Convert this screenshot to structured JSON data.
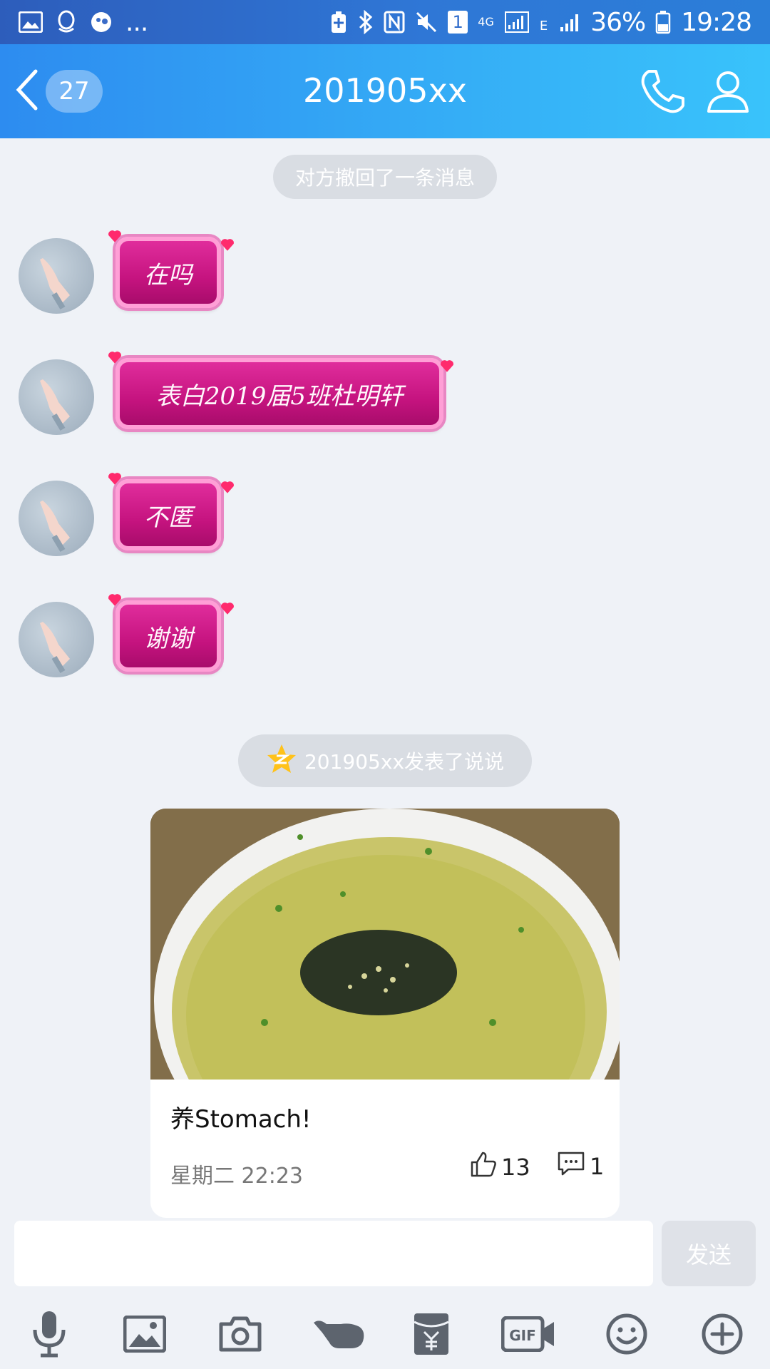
{
  "status_bar": {
    "battery": "36%",
    "time": "19:28",
    "network": "4G",
    "sim_badge": "1",
    "e_label": "E",
    "more": "..."
  },
  "header": {
    "back_count": "27",
    "title": "201905xx",
    "icons": [
      "back-icon",
      "phone-icon",
      "profile-icon"
    ]
  },
  "messages": {
    "recall_notice": "对方撤回了一条消息",
    "bubbles": [
      {
        "text": "在吗"
      },
      {
        "text": "表白2019届5班杜明轩"
      },
      {
        "text": "不匿"
      },
      {
        "text": "谢谢"
      }
    ],
    "posted_notice": "201905xx发表了说说"
  },
  "card": {
    "caption": "养Stomach!",
    "time": "星期二 22:23",
    "likes": "13",
    "comments": "1"
  },
  "composer": {
    "input_value": "",
    "send_label": "发送"
  },
  "toolbar": {
    "gif_label": "GIF",
    "icons": [
      "microphone-icon",
      "image-icon",
      "camera-icon",
      "poke-icon",
      "red-packet-icon",
      "gif-icon",
      "emoji-icon",
      "plus-icon"
    ]
  },
  "colors": {
    "header_start": "#2d8cf0",
    "header_end": "#39c3fb",
    "bubble": "#c5137f",
    "background": "#eff2f7"
  }
}
